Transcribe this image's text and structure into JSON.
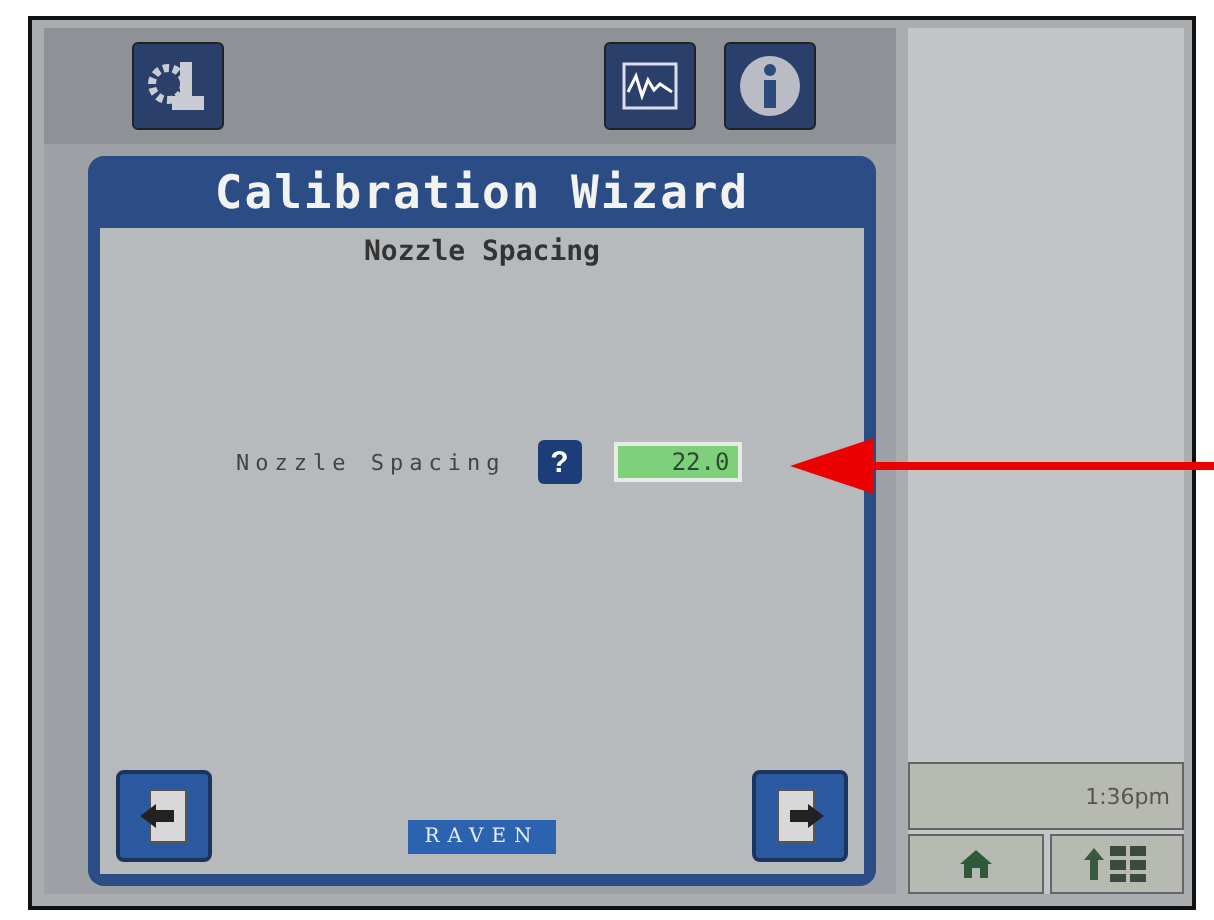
{
  "wizard": {
    "title": "Calibration Wizard",
    "subtitle": "Nozzle Spacing",
    "field": {
      "label": "Nozzle Spacing",
      "help": "?",
      "value": "22.0"
    },
    "logo": "RAVEN"
  },
  "status": {
    "time": "1:36pm"
  }
}
